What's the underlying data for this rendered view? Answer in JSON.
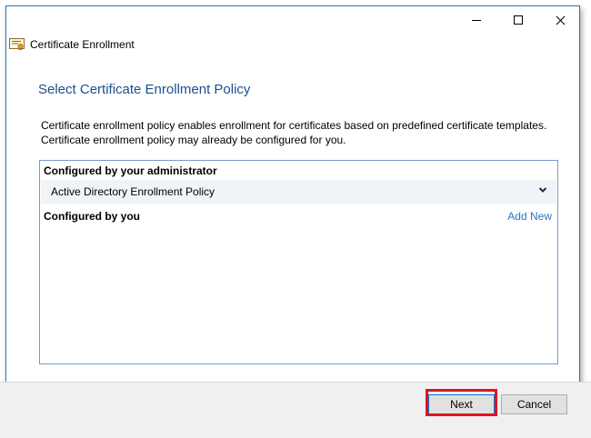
{
  "window": {
    "minimize_icon": "minimize-icon",
    "maximize_icon": "maximize-icon",
    "close_icon": "close-icon"
  },
  "header": {
    "app_title": "Certificate Enrollment",
    "app_icon": "certificate-icon"
  },
  "page": {
    "heading": "Select Certificate Enrollment Policy",
    "description_line1": "Certificate enrollment policy enables enrollment for certificates based on predefined certificate templates.",
    "description_line2": "Certificate enrollment policy may already be configured for you."
  },
  "policies": {
    "admin_section_label": "Configured by your administrator",
    "admin_policy_name": "Active Directory Enrollment Policy",
    "user_section_label": "Configured by you",
    "add_new_label": "Add New"
  },
  "footer": {
    "next_label": "Next",
    "cancel_label": "Cancel"
  },
  "colors": {
    "heading": "#1c4f91",
    "link": "#2e74c0",
    "highlight": "#e0141e"
  }
}
